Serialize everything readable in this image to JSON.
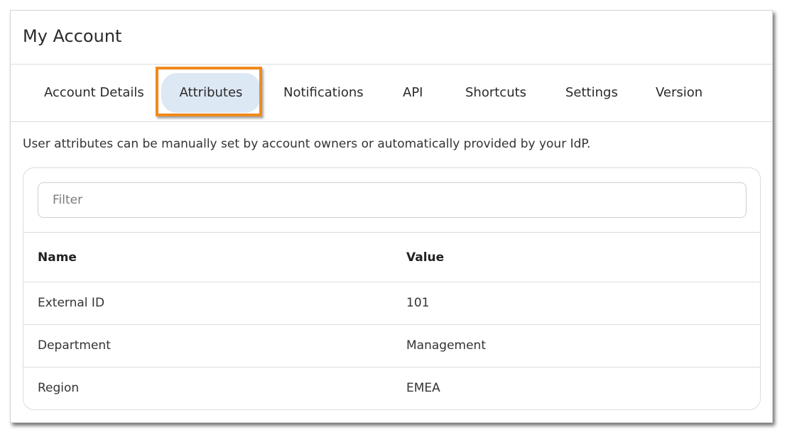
{
  "dialog": {
    "title": "My Account"
  },
  "tabs": [
    {
      "label": "Account Details",
      "active": false
    },
    {
      "label": "Attributes",
      "active": true
    },
    {
      "label": "Notifications",
      "active": false
    },
    {
      "label": "API",
      "active": false
    },
    {
      "label": "Shortcuts",
      "active": false
    },
    {
      "label": "Settings",
      "active": false
    },
    {
      "label": "Version",
      "active": false
    }
  ],
  "attributes": {
    "description": "User attributes can be manually set by account owners or automatically provided by your IdP.",
    "filter": {
      "placeholder": "Filter",
      "value": ""
    },
    "columns": [
      "Name",
      "Value"
    ],
    "rows": [
      {
        "name": "External ID",
        "value": "101"
      },
      {
        "name": "Department",
        "value": "Management"
      },
      {
        "name": "Region",
        "value": "EMEA"
      }
    ]
  },
  "colors": {
    "highlight": "#f08a1c",
    "active_tab_bg": "#dde8f5"
  }
}
